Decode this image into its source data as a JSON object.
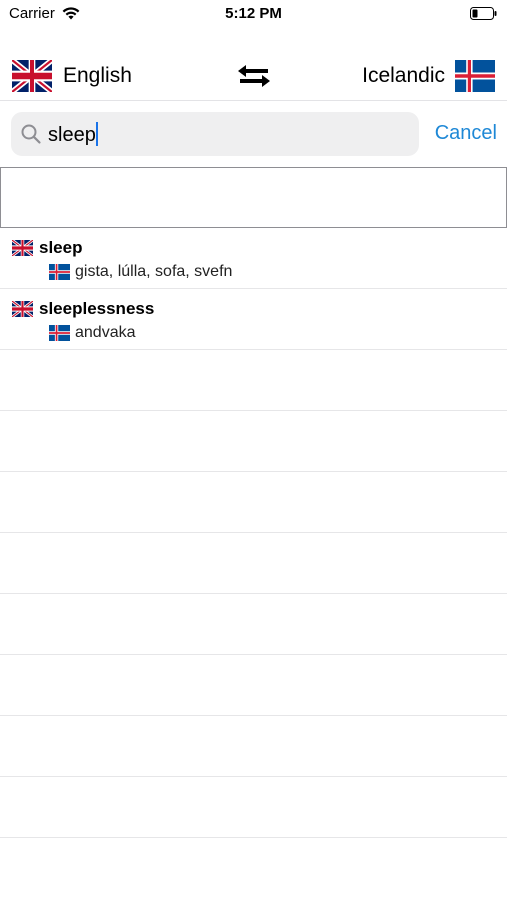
{
  "status": {
    "carrier": "Carrier",
    "time": "5:12 PM"
  },
  "languages": {
    "source": "English",
    "target": "Icelandic"
  },
  "search": {
    "query": "sleep",
    "cancel_label": "Cancel"
  },
  "results": [
    {
      "word": "sleep",
      "translation": "gista, lúlla, sofa, svefn"
    },
    {
      "word": "sleeplessness",
      "translation": "andvaka"
    }
  ],
  "empty_rows": 8,
  "colors": {
    "accent": "#1e88d6",
    "separator": "#e6e6e8",
    "search_bg": "#efeff0"
  }
}
